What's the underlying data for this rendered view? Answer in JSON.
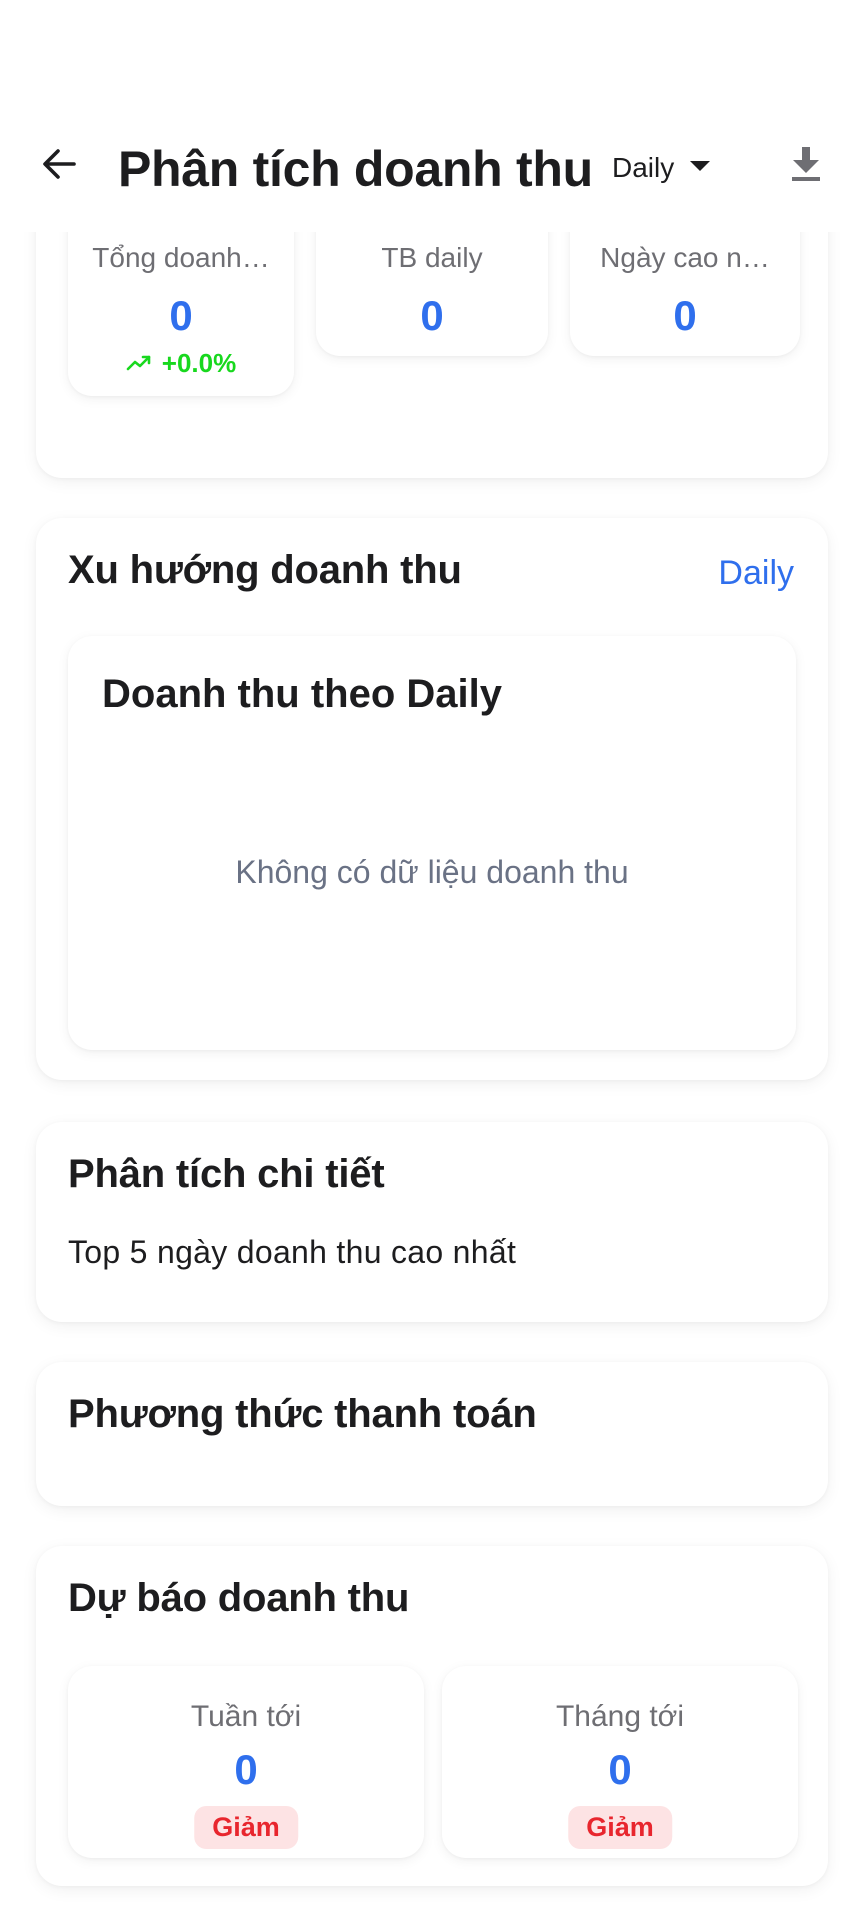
{
  "header": {
    "title": "Phân tích doanh thu",
    "period_selected": "Daily"
  },
  "summary": {
    "stats": [
      {
        "label": "Tổng doanh…",
        "value": "0",
        "change": "+0.0%"
      },
      {
        "label": "TB daily",
        "value": "0"
      },
      {
        "label": "Ngày cao n…",
        "value": "0"
      }
    ]
  },
  "trend": {
    "title": "Xu hướng doanh thu",
    "period_link": "Daily",
    "chart_title": "Doanh thu theo Daily",
    "empty_message": "Không có dữ liệu doanh thu"
  },
  "detail": {
    "title": "Phân tích chi tiết",
    "subtitle": "Top 5 ngày doanh thu cao nhất"
  },
  "payment": {
    "title": "Phương thức thanh toán"
  },
  "forecast": {
    "title": "Dự báo doanh thu",
    "items": [
      {
        "label": "Tuần tới",
        "value": "0",
        "badge": "Giảm"
      },
      {
        "label": "Tháng tới",
        "value": "0",
        "badge": "Giảm"
      }
    ]
  },
  "colors": {
    "accent": "#2f6fed",
    "positive": "#18d81e",
    "negative": "#e8262e",
    "negative_bg": "#fde3e4"
  },
  "icons": {
    "back": "arrow-left-icon",
    "dropdown": "caret-down-icon",
    "download": "download-icon",
    "trend": "trending-up-icon"
  }
}
